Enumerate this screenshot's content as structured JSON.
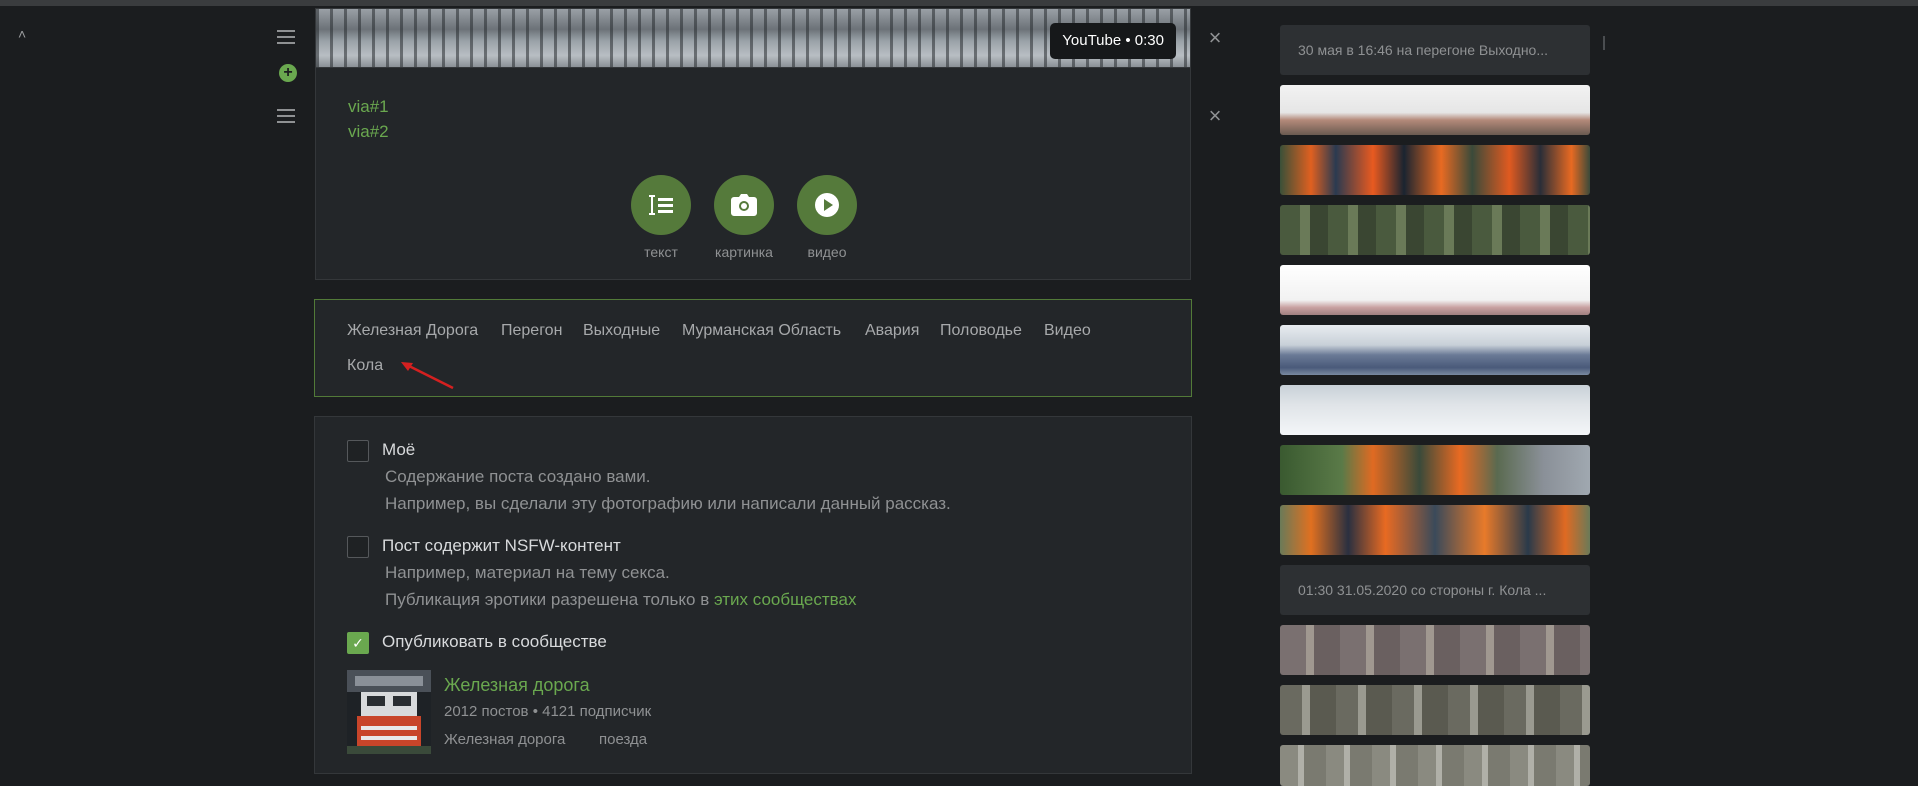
{
  "video": {
    "badge": "YouTube • 0:30"
  },
  "links": [
    "via#1",
    "via#2"
  ],
  "tools": [
    {
      "label": "текст",
      "icon": "text-icon"
    },
    {
      "label": "картинка",
      "icon": "camera-icon"
    },
    {
      "label": "видео",
      "icon": "play-icon"
    }
  ],
  "tags": [
    "Железная Дорога",
    "Перегон",
    "Выходные",
    "Мурманская Область",
    "Авария",
    "Половодье",
    "Видео",
    "Кола"
  ],
  "options": {
    "mine": {
      "title": "Моё",
      "desc1": "Содержание поста создано вами.",
      "desc2": "Например, вы сделали эту фотографию или написали данный рассказ.",
      "checked": false
    },
    "nsfw": {
      "title": "Пост содержит NSFW-контент",
      "desc1": "Например, материал на тему секса.",
      "desc2_prefix": "Публикация эротики разрешена только в ",
      "desc2_link": "этих сообществах",
      "checked": false
    },
    "community": {
      "title": "Опубликовать в сообществе",
      "checked": true
    }
  },
  "community": {
    "name": "Железная дорога",
    "posts": "2012 постов",
    "separator": "•",
    "subscribers": "4121 подписчик",
    "tag1": "Железная дорога",
    "tag2": "поезда"
  },
  "sidebar": {
    "caption1": "30 мая в 16:46 на перегоне Выходно...",
    "caption2": "01:30 31.05.2020 со стороны г. Кола ..."
  },
  "colors": {
    "accent": "#6aa84f",
    "tool_button": "#557a3b",
    "background": "#1b1d1f",
    "panel": "#232629",
    "annotation_arrow": "#d42020"
  }
}
